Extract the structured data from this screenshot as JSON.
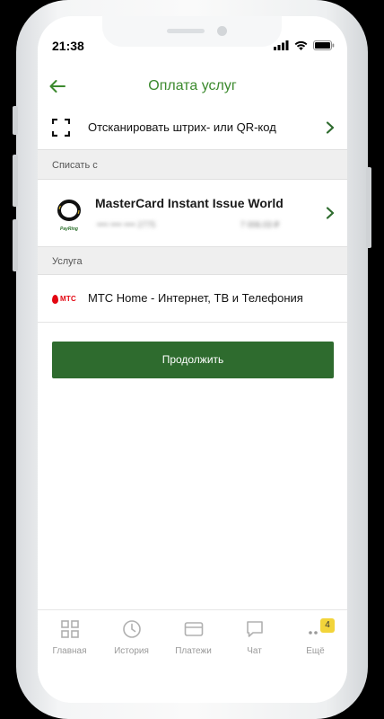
{
  "status_bar": {
    "time": "21:38"
  },
  "header": {
    "title": "Оплата услуг"
  },
  "scan": {
    "label": "Отсканировать штрих- или QR-код"
  },
  "debit_section": {
    "label": "Списать с"
  },
  "card": {
    "name": "MasterCard Instant Issue World",
    "number_masked": "•••• •••• •••• 2775",
    "balance": "7 006.03 ₽",
    "logo_text": "PayRing"
  },
  "service_section": {
    "label": "Услуга"
  },
  "service": {
    "provider_logo": "МТС",
    "name": "МТС Home - Интернет, ТВ и Телефония"
  },
  "continue_button": {
    "label": "Продолжить"
  },
  "tab_bar": {
    "items": [
      {
        "label": "Главная",
        "icon": "grid-icon"
      },
      {
        "label": "История",
        "icon": "clock-icon"
      },
      {
        "label": "Платежи",
        "icon": "card-icon"
      },
      {
        "label": "Чат",
        "icon": "chat-icon"
      },
      {
        "label": "Ещё",
        "icon": "more-icon",
        "badge": "4"
      }
    ]
  },
  "colors": {
    "accent_green": "#3c8a2e",
    "button_green": "#2e6b2e",
    "badge_yellow": "#f2d43a",
    "mts_red": "#e30611"
  }
}
